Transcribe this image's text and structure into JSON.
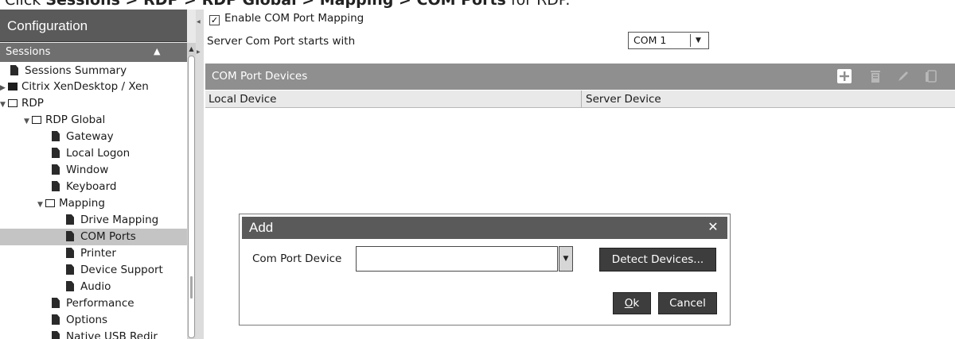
{
  "instruction": {
    "prefix": "Click ",
    "path_sessions": "Sessions",
    "sep": " > ",
    "path_rdp": "RDP",
    "path_rdp_global": "RDP Global",
    "path_mapping": "Mapping",
    "path_com_ports": "COM Ports",
    "suffix": " for RDP."
  },
  "sidebar": {
    "title": "Configuration",
    "section_label": "Sessions",
    "tree": [
      {
        "label": "Sessions Summary",
        "icon": "document-icon"
      },
      {
        "label": "Citrix XenDesktop / Xen",
        "icon": "folder-closed-icon"
      },
      {
        "label": "RDP",
        "icon": "folder-open-icon"
      },
      {
        "label": "RDP Global",
        "icon": "folder-open-icon"
      },
      {
        "label": "Gateway",
        "icon": "document-icon"
      },
      {
        "label": "Local Logon",
        "icon": "document-icon"
      },
      {
        "label": "Window",
        "icon": "document-icon"
      },
      {
        "label": "Keyboard",
        "icon": "document-icon"
      },
      {
        "label": "Mapping",
        "icon": "folder-open-icon"
      },
      {
        "label": "Drive Mapping",
        "icon": "document-icon"
      },
      {
        "label": "COM Ports",
        "icon": "document-icon",
        "selected": true
      },
      {
        "label": "Printer",
        "icon": "document-icon"
      },
      {
        "label": "Device Support",
        "icon": "document-icon"
      },
      {
        "label": "Audio",
        "icon": "document-icon"
      },
      {
        "label": "Performance",
        "icon": "document-icon"
      },
      {
        "label": "Options",
        "icon": "document-icon"
      },
      {
        "label": "Native USB Redir",
        "icon": "document-icon"
      }
    ]
  },
  "main": {
    "enable_label": "Enable COM Port Mapping",
    "enable_checked": true,
    "server_port_label": "Server Com Port starts with",
    "server_port_value": "COM 1",
    "devices_title": "COM Port Devices",
    "toolbar_icons": [
      "add-icon",
      "delete-icon",
      "edit-icon",
      "copy-icon"
    ],
    "columns": [
      "Local Device",
      "Server Device"
    ]
  },
  "dialog": {
    "title": "Add",
    "field_label": "Com Port Device",
    "field_value": "",
    "detect_button": "Detect Devices...",
    "ok_button_underline": "O",
    "ok_button_rest": "k",
    "cancel_button": "Cancel"
  },
  "colors": {
    "header_dark": "#5a5a5a",
    "section_bar": "#6f6f6f",
    "devices_bar": "#8f8f8f",
    "button_dark": "#3d3d3d",
    "selected_row": "#c4c4c4"
  }
}
